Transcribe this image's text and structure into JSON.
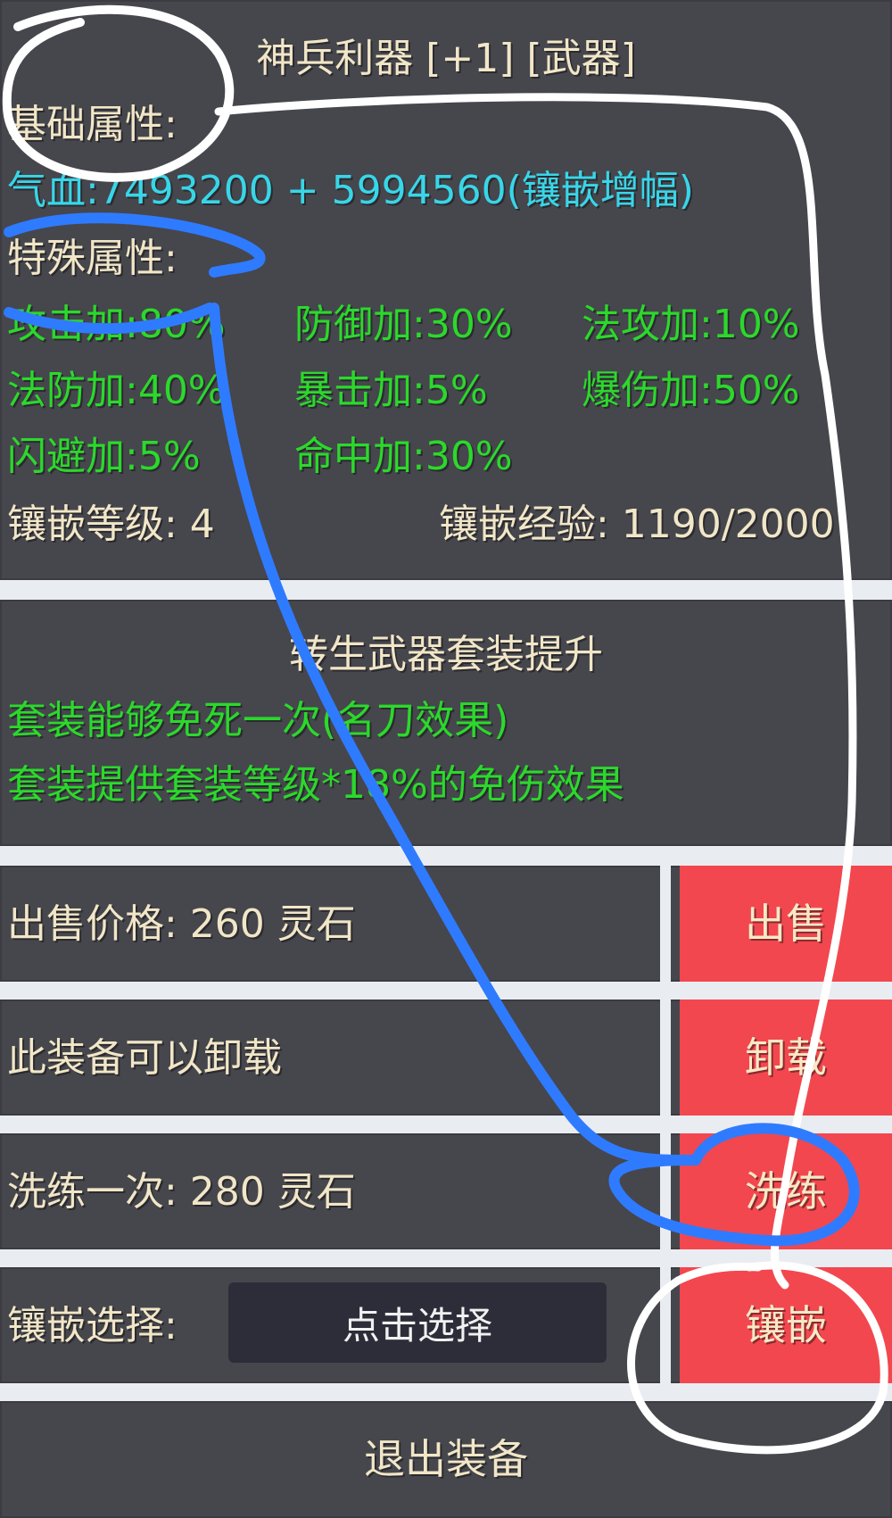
{
  "item": {
    "title": "神兵利器 [+1] [武器]",
    "base_label": "基础属性:",
    "base_value": "气血:7493200 + 5994560(镶嵌增幅)",
    "special_label": "特殊属性:",
    "attrs": [
      "攻击加:80%",
      "防御加:30%",
      "法攻加:10%",
      "法防加:40%",
      "暴击加:5%",
      "爆伤加:50%",
      "闪避加:5%",
      "命中加:30%"
    ],
    "inlay_level": "镶嵌等级: 4",
    "inlay_exp": "镶嵌经验: 1190/2000"
  },
  "set": {
    "title": "转生武器套装提升",
    "line1": "套装能够免死一次(名刀效果)",
    "line2": "套装提供套装等级*18%的免伤效果"
  },
  "actions": {
    "sell_price": "出售价格: 260 灵石",
    "sell_button": "出售",
    "unload_text": "此装备可以卸载",
    "unload_button": "卸载",
    "refine_price": "洗练一次: 280 灵石",
    "refine_button": "洗练",
    "inlay_select_label": "镶嵌选择:",
    "inlay_select_value": "点击选择",
    "inlay_button": "镶嵌",
    "exit": "退出装备"
  },
  "colors": {
    "panel": "#46464d",
    "button": "#f2474f",
    "cyan_text": "#38d6e8",
    "green_text": "#2bd92b",
    "tan_text": "#f1e6c7"
  }
}
